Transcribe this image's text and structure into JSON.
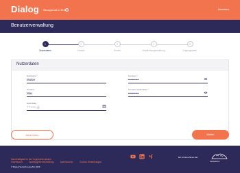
{
  "header": {
    "logo": "Dialog",
    "session": "Sitzungsende in 30:00",
    "logout": "Abmelden"
  },
  "title": "Benutzerverwaltung",
  "stepper": {
    "steps": [
      {
        "number": "1",
        "label": "Nutzerdaten",
        "active": true
      },
      {
        "number": "2",
        "label": "Kontakt",
        "active": false
      },
      {
        "number": "3",
        "label": "Rechte",
        "active": false
      },
      {
        "number": "4",
        "label": "Verpflichtungserklärung",
        "active": false
      },
      {
        "number": "5",
        "label": "Zugangsdaten",
        "active": false
      }
    ]
  },
  "form": {
    "section_title": "Nutzerdaten",
    "nachname": {
      "label": "Nachname *",
      "value": "Mutter"
    },
    "vorname": {
      "label": "Vorname",
      "value": "Max"
    },
    "geburtstag": {
      "label": "Geburtstag",
      "placeholder": "TT.mm.jjjj"
    },
    "kennwort": {
      "label": "Kennwort *",
      "value": "••••••••••"
    },
    "kennwort_wiederholen": {
      "label": "Kennwort wiederholen *",
      "value": "••••••••••"
    }
  },
  "actions": {
    "back": "Abbrechen",
    "next": "Weiter"
  },
  "footer": {
    "links": [
      "Impressum",
      "Auftraggeberverwaltung",
      "Datenschutz",
      "Cookie-Einstellungen"
    ],
    "link_row2": "Nachhaltigkeit in der Vogelschiessbahn",
    "copyright": "© Dialog Versicherung AG 2023",
    "social": [
      "youtube-icon",
      "linkedin-icon",
      "xing-icon"
    ],
    "partner_text": "Ein Unternehmen der",
    "partner_name": "GENERALI"
  },
  "colors": {
    "accent": "#f2744f",
    "navy": "#2d2a5a"
  }
}
